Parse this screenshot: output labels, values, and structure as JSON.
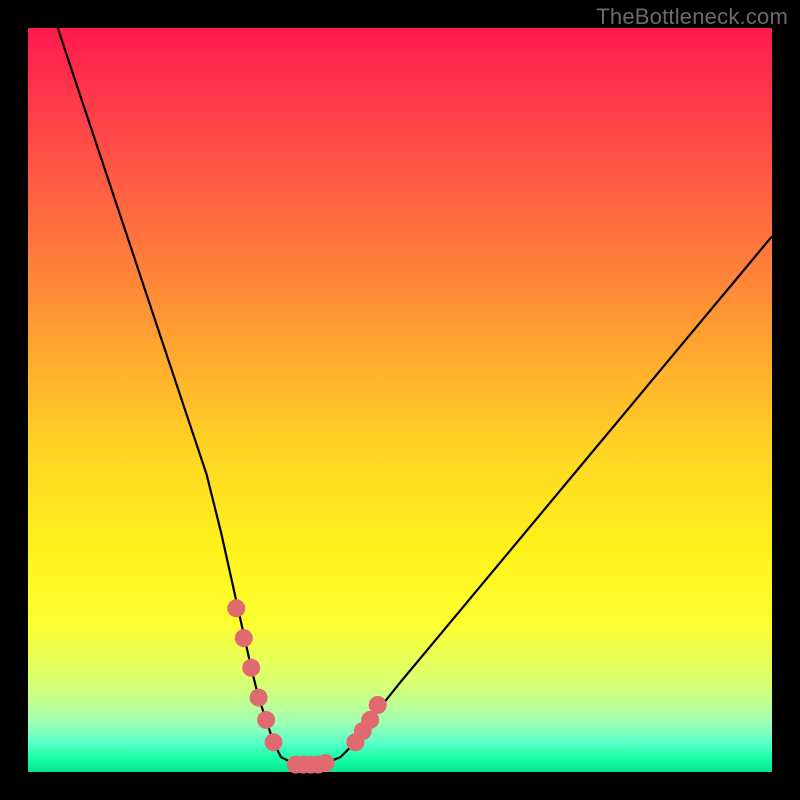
{
  "watermark": "TheBottleneck.com",
  "colors": {
    "background": "#000000",
    "gradient_top": "#ff1a4d",
    "gradient_mid": "#ffd823",
    "gradient_bottom": "#00e88e",
    "curve": "#000000",
    "markers": "#e06a6f"
  },
  "chart_data": {
    "type": "line",
    "title": "",
    "xlabel": "",
    "ylabel": "",
    "xlim": [
      0,
      100
    ],
    "ylim": [
      0,
      100
    ],
    "x": [
      4,
      6,
      8,
      10,
      12,
      14,
      16,
      18,
      20,
      22,
      24,
      26,
      28,
      30,
      31,
      32,
      33,
      34,
      35,
      36,
      37,
      38,
      39,
      40,
      42,
      44,
      46,
      50,
      55,
      60,
      65,
      70,
      75,
      80,
      85,
      90,
      95,
      100
    ],
    "y": [
      100,
      94,
      88,
      82,
      76,
      70,
      64,
      58,
      52,
      46,
      40,
      32,
      23,
      14,
      10,
      7,
      4,
      2,
      1.5,
      1.2,
      1.0,
      1.0,
      1.0,
      1.2,
      2,
      4,
      7,
      12,
      18,
      24,
      30,
      36,
      42,
      48,
      54,
      60,
      66,
      72
    ],
    "markers": {
      "x": [
        28,
        29,
        30,
        31,
        32,
        33,
        36,
        37,
        38,
        39,
        40,
        44,
        45,
        46,
        47
      ],
      "y": [
        22,
        18,
        14,
        10,
        7,
        4,
        1.0,
        1.0,
        1.0,
        1.0,
        1.2,
        4,
        5.5,
        7,
        9
      ]
    }
  }
}
